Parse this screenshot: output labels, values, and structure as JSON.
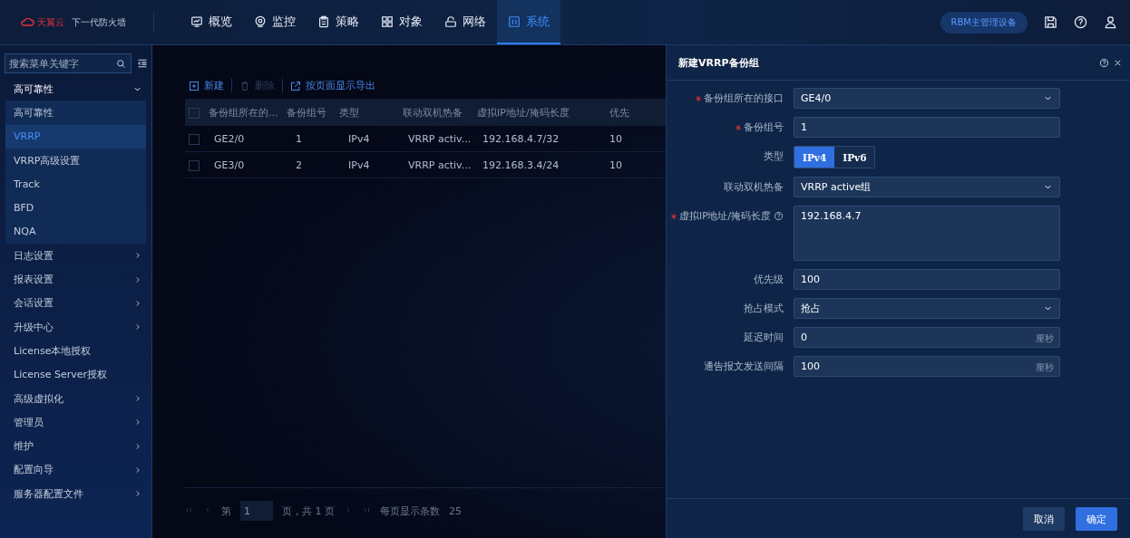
{
  "header": {
    "brand": "天翼云",
    "product": "下一代防火墙",
    "nav": [
      {
        "label": "概览",
        "selected": false
      },
      {
        "label": "监控",
        "selected": false
      },
      {
        "label": "策略",
        "selected": false
      },
      {
        "label": "对象",
        "selected": false
      },
      {
        "label": "网络",
        "selected": false
      },
      {
        "label": "系统",
        "selected": true
      }
    ],
    "device_badge": "RBM主管理设备"
  },
  "sidebar": {
    "search": {
      "placeholder": "搜索菜单关键字"
    },
    "items": [
      {
        "label": "高可靠性",
        "kind": "group",
        "expanded": true,
        "children": [
          {
            "label": "高可靠性",
            "selected": false
          },
          {
            "label": "VRRP",
            "selected": true
          },
          {
            "label": "VRRP高级设置",
            "selected": false
          },
          {
            "label": "Track",
            "selected": false
          },
          {
            "label": "BFD",
            "selected": false
          },
          {
            "label": "NQA",
            "selected": false
          }
        ]
      },
      {
        "label": "日志设置",
        "kind": "group",
        "expanded": false
      },
      {
        "label": "报表设置",
        "kind": "group",
        "expanded": false
      },
      {
        "label": "会话设置",
        "kind": "group",
        "expanded": false
      },
      {
        "label": "升级中心",
        "kind": "group",
        "expanded": false
      },
      {
        "label": "License本地授权",
        "kind": "link"
      },
      {
        "label": "License Server授权",
        "kind": "link"
      },
      {
        "label": "高级虚拟化",
        "kind": "group",
        "expanded": false
      },
      {
        "label": "管理员",
        "kind": "group",
        "expanded": false
      },
      {
        "label": "维护",
        "kind": "group",
        "expanded": false
      },
      {
        "label": "配置向导",
        "kind": "group",
        "expanded": false
      },
      {
        "label": "服务器配置文件",
        "kind": "group",
        "expanded": false
      }
    ]
  },
  "toolbar": [
    {
      "label": "新建",
      "kind": "add",
      "disabled": false
    },
    {
      "label": "删除",
      "kind": "delete",
      "disabled": true
    },
    {
      "label": "按页面显示导出",
      "kind": "export",
      "disabled": false
    }
  ],
  "table": {
    "all_checked": false,
    "columns": [
      "备份组所在的...",
      "备份组号",
      "类型",
      "联动双机热备",
      "虚拟IP地址/掩码长度",
      "优先"
    ],
    "rows": [
      {
        "checked": false,
        "cells": [
          "GE2/0",
          "1",
          "IPv4",
          "VRRP activ...",
          "192.168.4.7/32",
          "10"
        ]
      },
      {
        "checked": false,
        "cells": [
          "GE3/0",
          "2",
          "IPv4",
          "VRRP activ...",
          "192.168.3.4/24",
          "10"
        ]
      }
    ]
  },
  "pagination": {
    "page_prefix": "第",
    "page": "1",
    "page_suffix": "页，共 1 页",
    "per_page_label": "每页显示条数",
    "per_page": "25"
  },
  "drawer": {
    "title": "新建VRRP备份组",
    "fields": [
      {
        "kind": "select",
        "label": "备份组所在的接口",
        "required": true,
        "value": "GE4/0"
      },
      {
        "kind": "input",
        "label": "备份组号",
        "required": true,
        "value": "1"
      },
      {
        "kind": "toggle",
        "label": "类型",
        "required": false,
        "options": [
          {
            "label": "IPv4",
            "selected": true
          },
          {
            "label": "IPv6",
            "selected": false
          }
        ]
      },
      {
        "kind": "select",
        "label": "联动双机热备",
        "required": false,
        "value": "VRRP active组"
      },
      {
        "kind": "textarea",
        "label": "虚拟IP地址/掩码长度",
        "required": true,
        "help": true,
        "value": "192.168.4.7"
      },
      {
        "kind": "input",
        "label": "优先级",
        "required": false,
        "value": "100"
      },
      {
        "kind": "select",
        "label": "抢占模式",
        "required": false,
        "value": "抢占"
      },
      {
        "kind": "input",
        "label": "延迟时间",
        "required": false,
        "value": "0",
        "unit": "厘秒"
      },
      {
        "kind": "input",
        "label": "通告报文发送间隔",
        "required": false,
        "value": "100",
        "unit": "厘秒"
      }
    ],
    "buttons": [
      {
        "label": "取消",
        "kind": "secondary"
      },
      {
        "label": "确定",
        "kind": "primary"
      }
    ]
  }
}
